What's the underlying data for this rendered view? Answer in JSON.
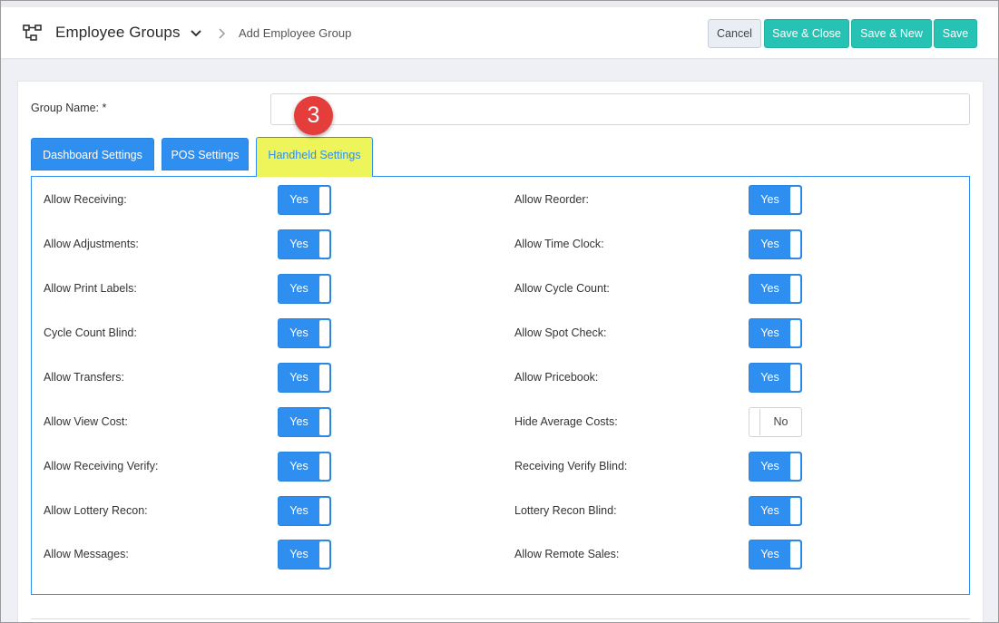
{
  "header": {
    "title": "Employee Groups",
    "breadcrumb": "Add Employee Group",
    "icon": "hierarchy-icon",
    "buttons": {
      "cancel": "Cancel",
      "save_close": "Save & Close",
      "save_new": "Save & New",
      "save": "Save"
    }
  },
  "form": {
    "group_name_label": "Group Name: *",
    "group_name_value": ""
  },
  "marker": "3",
  "tabs": [
    "Dashboard Settings",
    "POS Settings",
    "Handheld Settings"
  ],
  "active_tab": "Handheld Settings",
  "settings": {
    "left": [
      {
        "label": "Allow Receiving:",
        "value": "Yes"
      },
      {
        "label": "Allow Adjustments:",
        "value": "Yes"
      },
      {
        "label": "Allow Print Labels:",
        "value": "Yes"
      },
      {
        "label": "Cycle Count Blind:",
        "value": "Yes"
      },
      {
        "label": "Allow Transfers:",
        "value": "Yes"
      },
      {
        "label": "Allow View Cost:",
        "value": "Yes"
      },
      {
        "label": "Allow Receiving Verify:",
        "value": "Yes"
      },
      {
        "label": "Allow Lottery Recon:",
        "value": "Yes"
      },
      {
        "label": "Allow Messages:",
        "value": "Yes"
      }
    ],
    "right": [
      {
        "label": "Allow Reorder:",
        "value": "Yes"
      },
      {
        "label": "Allow Time Clock:",
        "value": "Yes"
      },
      {
        "label": "Allow Cycle Count:",
        "value": "Yes"
      },
      {
        "label": "Allow Spot Check:",
        "value": "Yes"
      },
      {
        "label": "Allow Pricebook:",
        "value": "Yes"
      },
      {
        "label": "Hide Average Costs:",
        "value": "No"
      },
      {
        "label": "Receiving Verify Blind:",
        "value": "Yes"
      },
      {
        "label": "Lottery Recon Blind:",
        "value": "Yes"
      },
      {
        "label": "Allow Remote Sales:",
        "value": "Yes"
      }
    ]
  },
  "colors": {
    "accent_blue": "#2f8ff0",
    "teal": "#26c3b5",
    "highlight": "#eef55a",
    "marker_red": "#e53c3c"
  }
}
